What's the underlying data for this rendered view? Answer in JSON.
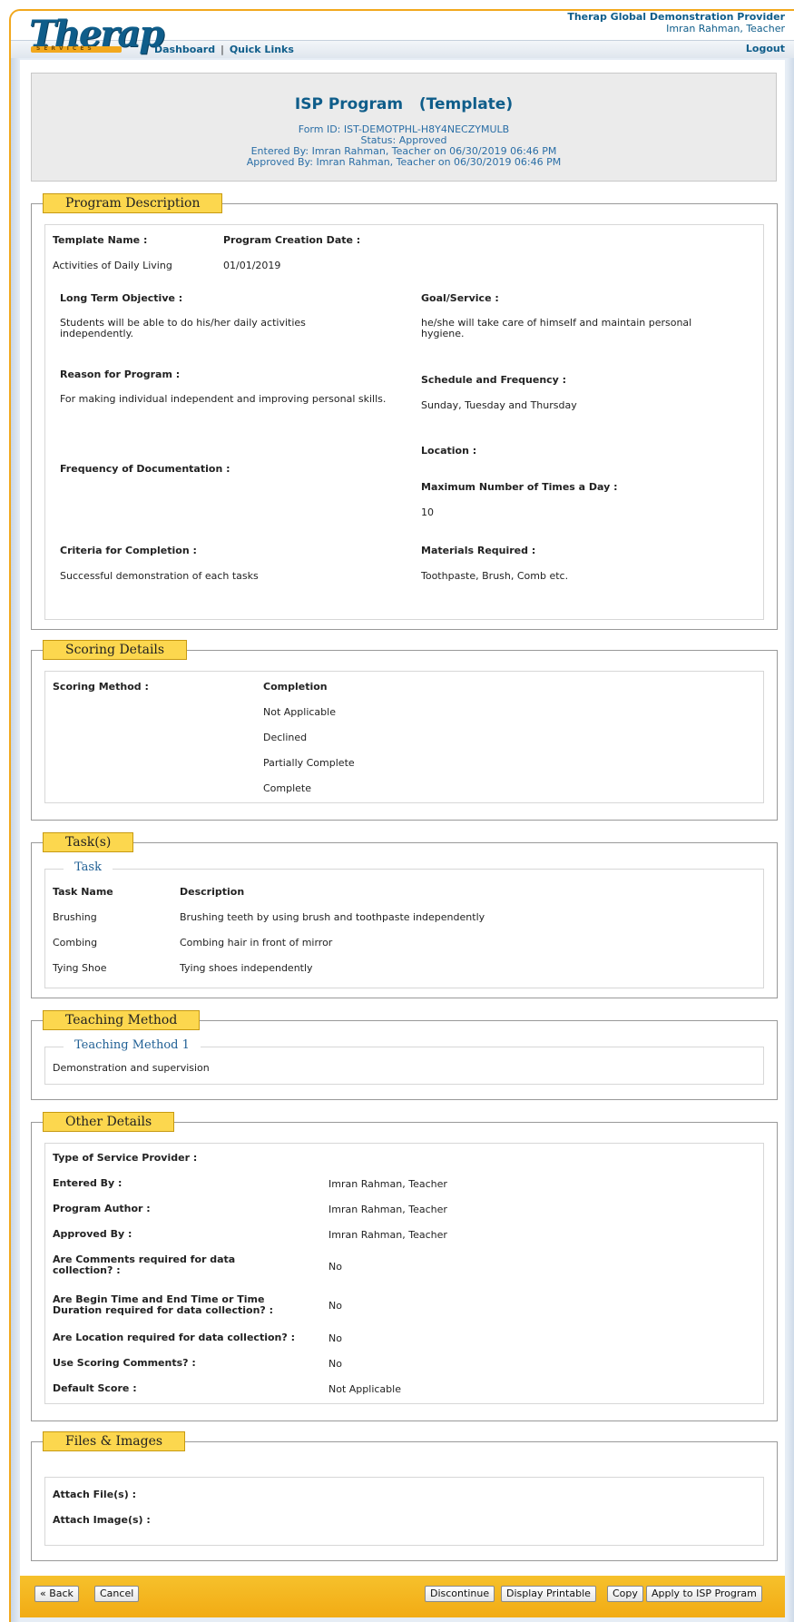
{
  "header": {
    "logo_text": "Therap",
    "logo_sub": "SERVICES",
    "provider_name": "Therap Global Demonstration Provider",
    "user_name": "Imran Rahman, Teacher",
    "nav_dashboard": "Dashboard",
    "nav_separator": "|",
    "nav_quick_links": "Quick Links",
    "logout": "Logout"
  },
  "form": {
    "title": "ISP Program   (Template)",
    "form_id": "Form ID: IST-DEMOTPHL-H8Y4NECZYMULB",
    "status": "Status: Approved",
    "entered_by": "Entered By: Imran Rahman, Teacher  on 06/30/2019 06:46 PM",
    "approved_by": "Approved By: Imran Rahman, Teacher  on 06/30/2019 06:46 PM"
  },
  "program_description": {
    "legend": "Program Description",
    "template_name_label": "Template Name :",
    "template_name_value": "Activities of Daily Living",
    "creation_date_label": "Program Creation Date :",
    "creation_date_value": "01/01/2019",
    "long_term_objective_label": "Long Term Objective :",
    "long_term_objective_value": "Students will be able to do his/her daily activities independently.",
    "goal_service_label": "Goal/Service :",
    "goal_service_value": "he/she will take care of himself and maintain personal hygiene.",
    "reason_label": "Reason for Program :",
    "reason_value": "For making individual independent and improving personal skills.",
    "schedule_label": "Schedule and Frequency :",
    "schedule_value": "Sunday, Tuesday and Thursday",
    "location_label": "Location :",
    "frequency_doc_label": "Frequency of Documentation :",
    "max_times_label": "Maximum Number of Times a Day :",
    "max_times_value": "10",
    "criteria_label": "Criteria for Completion :",
    "criteria_value": "Successful demonstration of each tasks",
    "materials_label": "Materials Required :",
    "materials_value": "Toothpaste, Brush, Comb etc."
  },
  "scoring": {
    "legend": "Scoring Details",
    "method_label": "Scoring Method :",
    "method_value": "Completion",
    "options": [
      "Not Applicable",
      "Declined",
      "Partially Complete",
      "Complete"
    ]
  },
  "tasks": {
    "legend": "Task(s)",
    "sublegend": "Task",
    "col_name": "Task Name",
    "col_desc": "Description",
    "rows": [
      {
        "name": "Brushing",
        "desc": "Brushing teeth by using brush and toothpaste independently"
      },
      {
        "name": "Combing",
        "desc": "Combing hair in front of mirror"
      },
      {
        "name": "Tying Shoe",
        "desc": "Tying shoes independently"
      }
    ]
  },
  "teaching": {
    "legend": "Teaching Method",
    "sublegend": "Teaching Method 1",
    "value": "Demonstration and supervision"
  },
  "other": {
    "legend": "Other Details",
    "rows": [
      {
        "label": "Type of Service Provider :",
        "value": ""
      },
      {
        "label": "Entered By :",
        "value": "Imran Rahman, Teacher"
      },
      {
        "label": "Program Author :",
        "value": "Imran Rahman, Teacher"
      },
      {
        "label": "Approved By :",
        "value": "Imran Rahman, Teacher"
      },
      {
        "label": "Are Comments required for data collection? :",
        "value": "No"
      },
      {
        "label": "Are Begin Time and End Time or Time Duration required for data collection? :",
        "value": "No"
      },
      {
        "label": "Are Location required for data collection? :",
        "value": "No"
      },
      {
        "label": "Use Scoring Comments? :",
        "value": "No"
      },
      {
        "label": "Default Score :",
        "value": "Not Applicable"
      }
    ]
  },
  "files": {
    "legend": "Files & Images",
    "attach_files_label": "Attach File(s) :",
    "attach_images_label": "Attach Image(s) :"
  },
  "footer": {
    "back": "« Back",
    "cancel": "Cancel",
    "discontinue": "Discontinue",
    "display_printable": "Display Printable",
    "copy": "Copy",
    "apply": "Apply to ISP Program"
  }
}
